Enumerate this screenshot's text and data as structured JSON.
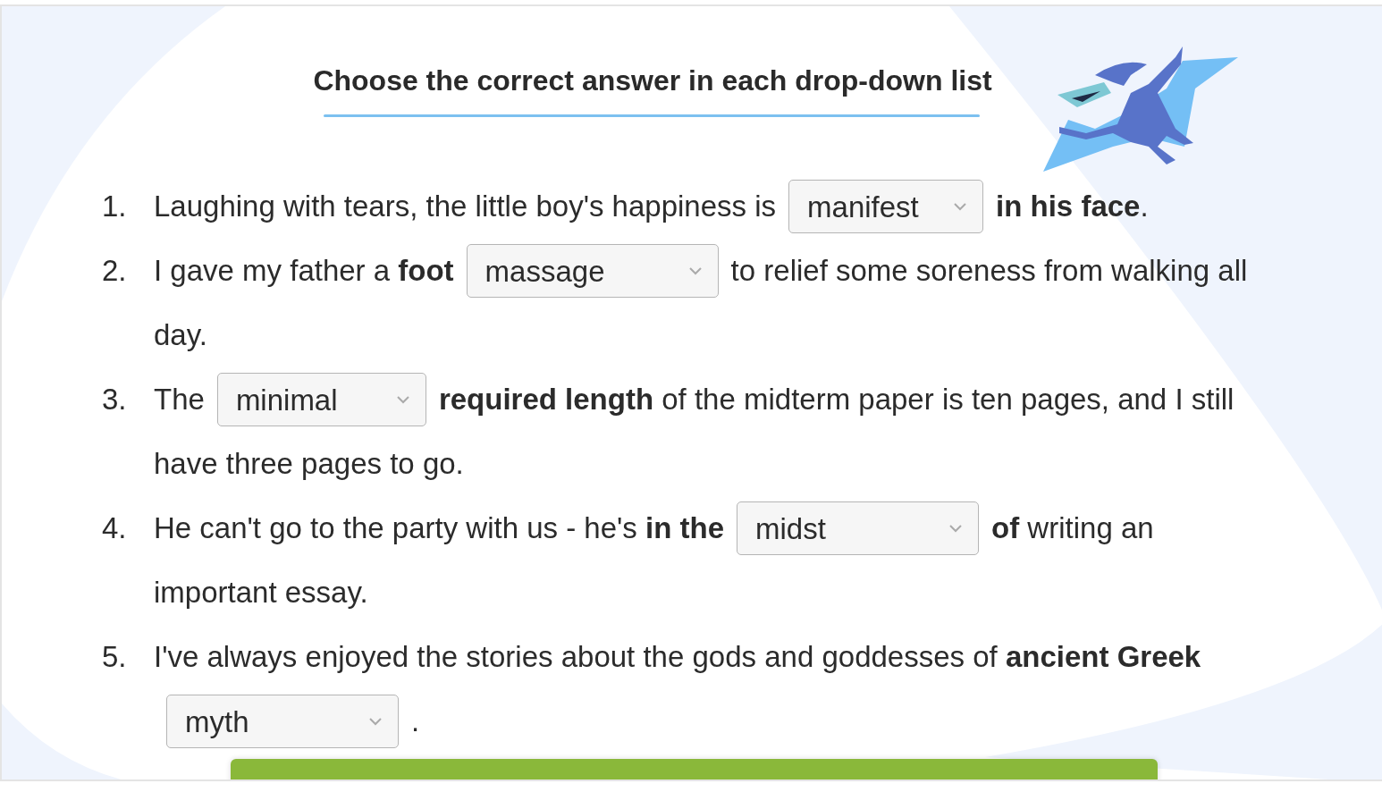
{
  "title": "Choose the correct answer in each drop-down list",
  "questions": [
    {
      "number": "1.",
      "parts": [
        {
          "kind": "text",
          "text": "Laughing with tears, the little boy's happiness is"
        },
        {
          "kind": "select",
          "value": "manifest"
        },
        {
          "kind": "text",
          "text": "**in his face**."
        }
      ]
    },
    {
      "number": "2.",
      "parts": [
        {
          "kind": "text",
          "text": "I gave my father a **foot**"
        },
        {
          "kind": "select",
          "value": "massage"
        },
        {
          "kind": "text",
          "text": "to relief some soreness from walking all"
        },
        {
          "kind": "text",
          "text": "day."
        }
      ]
    },
    {
      "number": "3.",
      "parts": [
        {
          "kind": "text",
          "text": "The"
        },
        {
          "kind": "select",
          "value": "minimal"
        },
        {
          "kind": "text",
          "text": "**required length** of the midterm paper is ten pages, and I still"
        },
        {
          "kind": "text",
          "text": "have three pages to go."
        }
      ]
    },
    {
      "number": "4.",
      "parts": [
        {
          "kind": "text",
          "text": "He can't go to the party with us - he's **in the**"
        },
        {
          "kind": "select",
          "value": "midst"
        },
        {
          "kind": "text",
          "text": "**of** writing an"
        },
        {
          "kind": "text",
          "text": "important essay."
        }
      ]
    },
    {
      "number": "5.",
      "parts": [
        {
          "kind": "text",
          "text": "I've always enjoyed the stories about the gods and goddesses of **ancient Greek**"
        },
        {
          "kind": "select",
          "value": "myth"
        },
        {
          "kind": "text",
          "text": "."
        }
      ]
    }
  ]
}
